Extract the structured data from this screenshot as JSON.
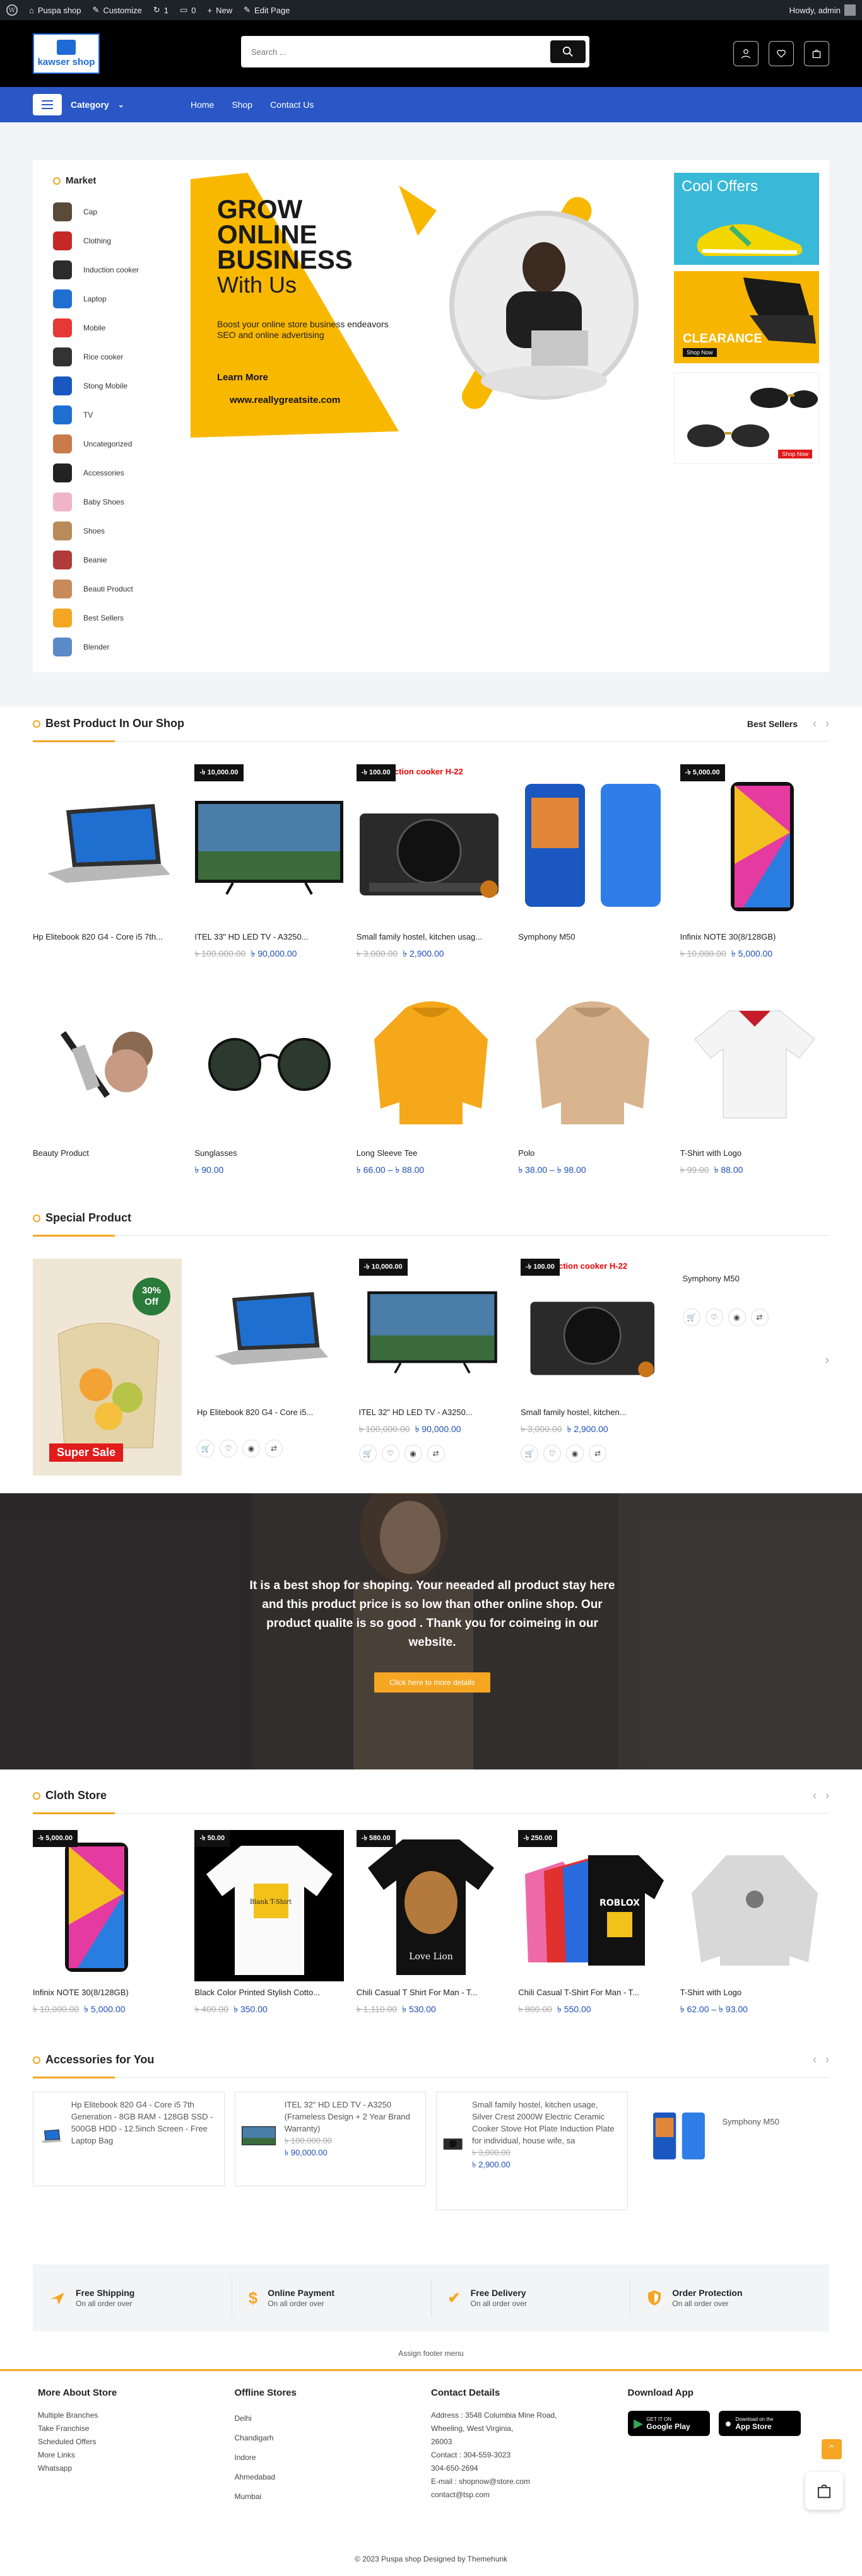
{
  "adminbar": {
    "site": "Puspa shop",
    "customize": "Customize",
    "updates": "1",
    "comments": "0",
    "new": "New",
    "edit": "Edit Page",
    "howdy": "Howdy, admin"
  },
  "header": {
    "logo_text": "kawser shop",
    "search_placeholder": "Search ..."
  },
  "nav": {
    "category": "Category",
    "links": [
      "Home",
      "Shop",
      "Contact Us"
    ]
  },
  "market": {
    "title": "Market",
    "items": [
      "Cap",
      "Clothing",
      "Induction cooker",
      "Laptop",
      "Mobile",
      "Rice cooker",
      "Stong Mobile",
      "TV",
      "Uncategorized",
      "Accessories",
      "Baby Shoes",
      "Shoes",
      "Beanie",
      "Beauti Product",
      "Best Sellers",
      "Blender"
    ]
  },
  "banner": {
    "l1": "GROW",
    "l2": "ONLINE",
    "l3": "BUSINESS",
    "l4": "With Us",
    "body": "Boost your online store business endeavors SEO and online advertising",
    "btn": "Learn More",
    "url": "www.reallygreatsite.com"
  },
  "side": {
    "offers": "Cool Offers",
    "clearance": "CLEARANCE",
    "shop_now": "Shop Now",
    "shop_now2": "Shop Now"
  },
  "best": {
    "title": "Best Product In Our Shop",
    "tab": "Best Sellers",
    "row1": [
      {
        "badge": "",
        "name": "Hp Elitebook 820 G4 - Core i5 7th...",
        "old": "",
        "new": ""
      },
      {
        "badge": "-৳ 10,000.00",
        "name": "ITEL 33\" HD LED TV - A3250...",
        "old": "৳ 100,000.00",
        "new": "৳ 90,000.00"
      },
      {
        "badge": "-৳ 100.00",
        "name": "Small family hostel, kitchen usag...",
        "old": "৳ 3,000.00",
        "new": "৳ 2,900.00"
      },
      {
        "badge": "",
        "name": "Symphony M50",
        "old": "",
        "new": ""
      },
      {
        "badge": "-৳ 5,000.00",
        "name": "Infinix NOTE 30(8/128GB)",
        "old": "৳ 10,000.00",
        "new": "৳ 5,000.00"
      }
    ],
    "row2": [
      {
        "name": "Beauty Product",
        "old": "",
        "new": ""
      },
      {
        "name": "Sunglasses",
        "old": "",
        "new": "৳ 90.00"
      },
      {
        "name": "Long Sleeve Tee",
        "old": "",
        "new": "৳ 66.00 – ৳ 88.00"
      },
      {
        "name": "Polo",
        "old": "",
        "new": "৳ 38.00 – ৳ 98.00"
      },
      {
        "name": "T-Shirt with Logo",
        "old": "৳ 99.00",
        "new": "৳ 88.00"
      }
    ]
  },
  "cooker_label": "ction cooker H-22",
  "special": {
    "title": "Special Product",
    "off_pct": "30%",
    "off": "Off",
    "sale": "Super Sale",
    "items": [
      {
        "badge": "",
        "name": "Hp Elitebook 820 G4 - Core i5...",
        "old": "",
        "new": ""
      },
      {
        "badge": "-৳ 10,000.00",
        "name": "ITEL 32\" HD LED TV - A3250...",
        "old": "৳ 100,000.00",
        "new": "৳ 90,000.00"
      },
      {
        "badge": "-৳ 100.00",
        "name": "Small family hostel, kitchen...",
        "old": "৳ 3,000.00",
        "new": "৳ 2,900.00"
      },
      {
        "badge": "",
        "name": "Symphony M50",
        "old": "",
        "new": ""
      }
    ]
  },
  "promo": {
    "text": "It is a best shop for shoping. Your neeaded all product stay here and this product price is so low than other online shop. Our product qualite is so good . Thank you for coimeing in our website.",
    "btn": "Click here to more details"
  },
  "cloth": {
    "title": "Cloth Store",
    "items": [
      {
        "badge": "-৳ 5,000.00",
        "name": "Infinix NOTE 30(8/128GB)",
        "old": "৳ 10,000.00",
        "new": "৳ 5,000.00"
      },
      {
        "badge": "-৳ 50.00",
        "name": "Black Color Printed Stylish Cotto...",
        "old": "৳ 400.00",
        "new": "৳ 350.00"
      },
      {
        "badge": "-৳ 580.00",
        "name": "Chili Casual T Shirt For Man - T...",
        "old": "৳ 1,110.00",
        "new": "৳ 530.00"
      },
      {
        "badge": "-৳ 250.00",
        "name": "Chili Casual T-Shirt For Man - T...",
        "old": "৳ 800.00",
        "new": "৳ 550.00"
      },
      {
        "badge": "",
        "name": "T-Shirt with Logo",
        "old": "",
        "new": "৳ 62.00 – ৳ 93.00"
      }
    ],
    "tee_text": "Blank T-Shirt",
    "roblox": "ROBLOX",
    "lion": "Love Lion"
  },
  "acc": {
    "title": "Accessories for You",
    "items": [
      {
        "name": "Hp Elitebook 820 G4 - Core i5 7th Generation - 8GB RAM - 128GB SSD - 500GB HDD - 12.5inch Screen - Free Laptop Bag",
        "old": "",
        "new": ""
      },
      {
        "name": "ITEL 32\" HD LED TV - A3250 (Frameless Design + 2 Year Brand Warranty)",
        "old": "৳ 100,000.00",
        "new": "৳ 90,000.00"
      },
      {
        "name": "Small family hostel, kitchen usage, Silver Crest 2000W Electric Ceramic Cooker Stove Hot Plate Induction Plate for individual, house wife, sa",
        "old": "৳ 3,000.00",
        "new": "৳ 2,900.00"
      },
      {
        "name": "Symphony M50",
        "old": "",
        "new": ""
      }
    ]
  },
  "features": [
    {
      "t": "Free Shipping",
      "s": "On all order over"
    },
    {
      "t": "Online Payment",
      "s": "On all order over"
    },
    {
      "t": "Free Delivery",
      "s": "On all order over"
    },
    {
      "t": "Order Protection",
      "s": "On all order over"
    }
  ],
  "footer_menu": "Assign footer menu",
  "footer": {
    "c1": {
      "t": "More About Store",
      "items": [
        "Multiple Branches",
        "Take Franchise",
        "Scheduled Offers",
        "More Links",
        "Whatsapp"
      ]
    },
    "c2": {
      "t": "Offline Stores",
      "items": [
        "Delhi",
        "Chandigarh",
        "Indore",
        "Ahmedabad",
        "Mumbai"
      ]
    },
    "c3": {
      "t": "Contact Details",
      "items": [
        "Address : 3548 Columbia Mine Road,",
        "Wheeling, West Virginia,",
        "26003",
        "Contact : 304-559-3023",
        "304-650-2694",
        "E-mail : shopnow@store.com",
        "contact@tsp.com"
      ]
    },
    "c4": {
      "t": "Download App",
      "gp_small": "GET IT ON",
      "gp": "Google Play",
      "as_small": "Download on the",
      "as": "App Store"
    }
  },
  "copyright": "© 2023 Puspa shop Designed by Themehunk"
}
